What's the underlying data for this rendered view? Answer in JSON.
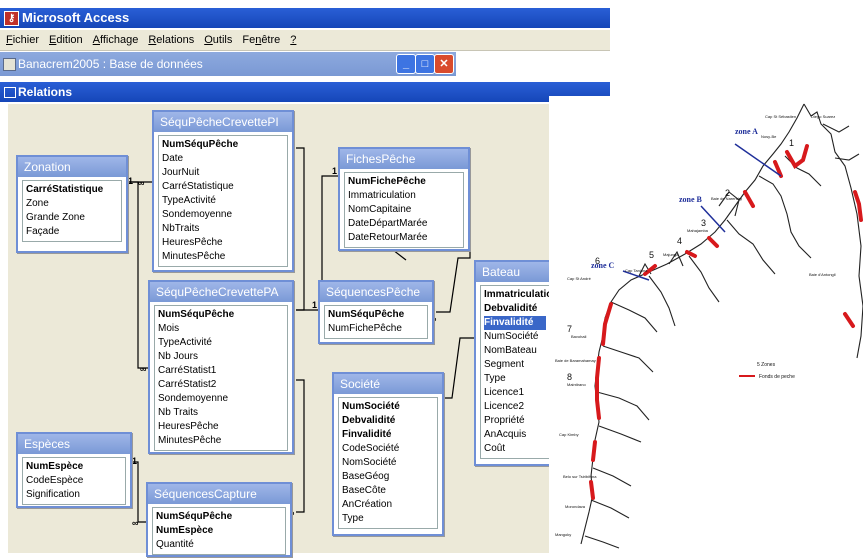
{
  "window": {
    "app_title": "Microsoft Access"
  },
  "menu": [
    {
      "pre": "",
      "ul": "F",
      "post": "ichier"
    },
    {
      "pre": "",
      "ul": "E",
      "post": "dition"
    },
    {
      "pre": "",
      "ul": "A",
      "post": "ffichage"
    },
    {
      "pre": "",
      "ul": "R",
      "post": "elations"
    },
    {
      "pre": "",
      "ul": "O",
      "post": "utils"
    },
    {
      "pre": "Fe",
      "ul": "n",
      "post": "être"
    },
    {
      "pre": "",
      "ul": "?",
      "post": ""
    }
  ],
  "db_window": {
    "title": "Banacrem2005 : Base de données"
  },
  "relations_window": {
    "title": "Relations"
  },
  "tables": {
    "zonation": {
      "name": "Zonation",
      "fields": [
        {
          "t": "CarréStatistique",
          "k": true
        },
        {
          "t": "Zone"
        },
        {
          "t": "Grande Zone"
        },
        {
          "t": "Façade"
        }
      ]
    },
    "sequ_pi": {
      "name": "SéquPêcheCrevettePI",
      "fields": [
        {
          "t": "NumSéquPêche",
          "k": true
        },
        {
          "t": "Date"
        },
        {
          "t": "JourNuit"
        },
        {
          "t": "CarréStatistique"
        },
        {
          "t": "TypeActivité"
        },
        {
          "t": "Sondemoyenne"
        },
        {
          "t": "NbTraits"
        },
        {
          "t": "HeuresPêche"
        },
        {
          "t": "MinutesPêche"
        }
      ]
    },
    "fiches": {
      "name": "FichesPêche",
      "fields": [
        {
          "t": "NumFichePêche",
          "k": true
        },
        {
          "t": "Immatriculation"
        },
        {
          "t": "NomCapitaine"
        },
        {
          "t": "DateDépartMarée"
        },
        {
          "t": "DateRetourMarée"
        }
      ]
    },
    "sequ_pa": {
      "name": "SéquPêcheCrevettePA",
      "fields": [
        {
          "t": "NumSéquPêche",
          "k": true
        },
        {
          "t": "Mois"
        },
        {
          "t": "TypeActivité"
        },
        {
          "t": "Nb Jours"
        },
        {
          "t": "CarréStatist1"
        },
        {
          "t": "CarréStatist2"
        },
        {
          "t": "Sondemoyenne"
        },
        {
          "t": "Nb Traits"
        },
        {
          "t": "HeuresPêche"
        },
        {
          "t": "MinutesPêche"
        }
      ]
    },
    "sequences": {
      "name": "SéquencesPêche",
      "fields": [
        {
          "t": "NumSéquPêche",
          "k": true
        },
        {
          "t": "NumFichePêche"
        }
      ]
    },
    "bateau": {
      "name": "Bateau",
      "fields": [
        {
          "t": "Immatriculation",
          "k": true
        },
        {
          "t": "Debvalidité",
          "k": true
        },
        {
          "t": "Finvalidité",
          "sel": true
        },
        {
          "t": "NumSociété"
        },
        {
          "t": "NomBateau"
        },
        {
          "t": "Segment"
        },
        {
          "t": "Type"
        },
        {
          "t": "Licence1"
        },
        {
          "t": "Licence2"
        },
        {
          "t": "Propriété"
        },
        {
          "t": "AnAcquis"
        },
        {
          "t": "Coût"
        }
      ]
    },
    "societe": {
      "name": "Société",
      "fields": [
        {
          "t": "NumSociété",
          "k": true
        },
        {
          "t": "Debvalidité",
          "k": true
        },
        {
          "t": "Finvalidité",
          "k": true
        },
        {
          "t": "CodeSociété"
        },
        {
          "t": "NomSociété"
        },
        {
          "t": "BaseGéog"
        },
        {
          "t": "BaseCôte"
        },
        {
          "t": "AnCréation"
        },
        {
          "t": "Type"
        }
      ]
    },
    "especes": {
      "name": "Espèces",
      "fields": [
        {
          "t": "NumEspèce",
          "k": true
        },
        {
          "t": "CodeEspèce"
        },
        {
          "t": "Signification"
        }
      ]
    },
    "captures": {
      "name": "SéquencesCapture",
      "fields": [
        {
          "t": "NumSéquPêche",
          "k": true
        },
        {
          "t": "NumEspèce",
          "k": true
        },
        {
          "t": "Quantité"
        }
      ]
    }
  },
  "relationship_labels": {
    "one": "1",
    "many": "∞"
  },
  "map": {
    "zones": [
      "zone A",
      "zone B",
      "zone C"
    ],
    "zone_numbers": [
      "1",
      "2",
      "3",
      "4",
      "5",
      "6",
      "7",
      "8"
    ],
    "places": [
      "Cap St Sébastien",
      "Diego Suarez",
      "Nosy-Be",
      "Baie de Narendry",
      "Mahajamba",
      "Majunga",
      "Cap Tanjona",
      "Cap St André",
      "Bavohali",
      "Baie de Baramahamay",
      "Maintirano",
      "Cap Kimby",
      "Belo sur Tsiribihina",
      "Morondava",
      "Mangoky",
      "Baie d'Antongil"
    ],
    "legend_count": "5 Zones",
    "legend_label": "Fonds de peche"
  }
}
